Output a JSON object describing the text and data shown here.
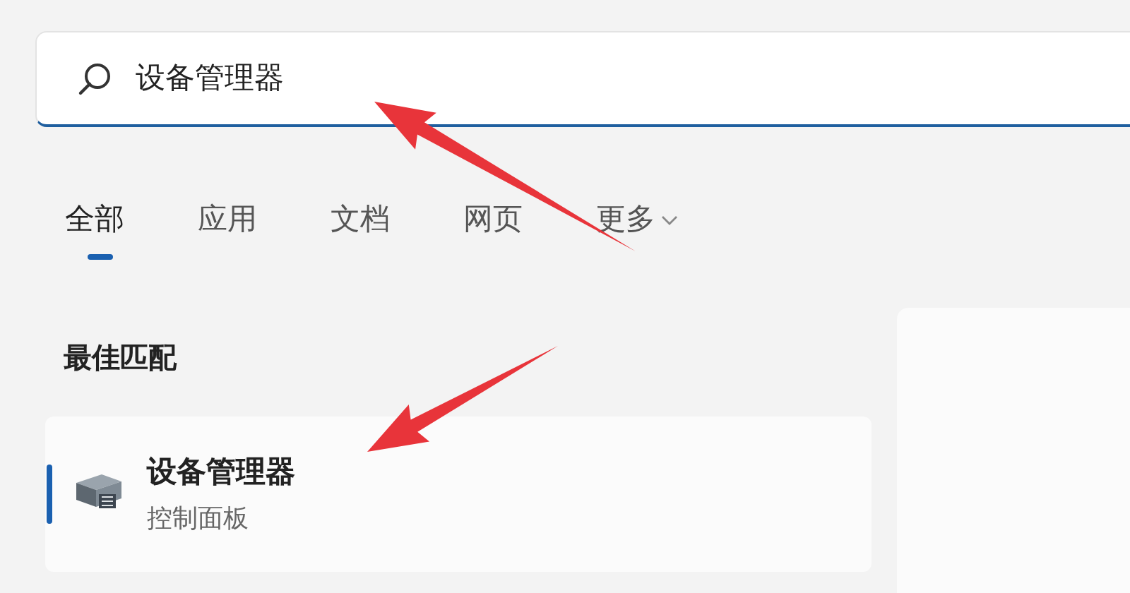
{
  "search": {
    "value": "设备管理器"
  },
  "tabs": [
    {
      "label": "全部",
      "selected": true
    },
    {
      "label": "应用",
      "selected": false
    },
    {
      "label": "文档",
      "selected": false
    },
    {
      "label": "网页",
      "selected": false
    },
    {
      "label": "更多",
      "selected": false,
      "kind": "dropdown"
    }
  ],
  "best_match": {
    "heading": "最佳匹配",
    "result": {
      "title": "设备管理器",
      "subtitle": "控制面板",
      "selected": true
    }
  },
  "arrows": [
    {
      "kind": "arrow"
    },
    {
      "kind": "arrow"
    }
  ]
}
